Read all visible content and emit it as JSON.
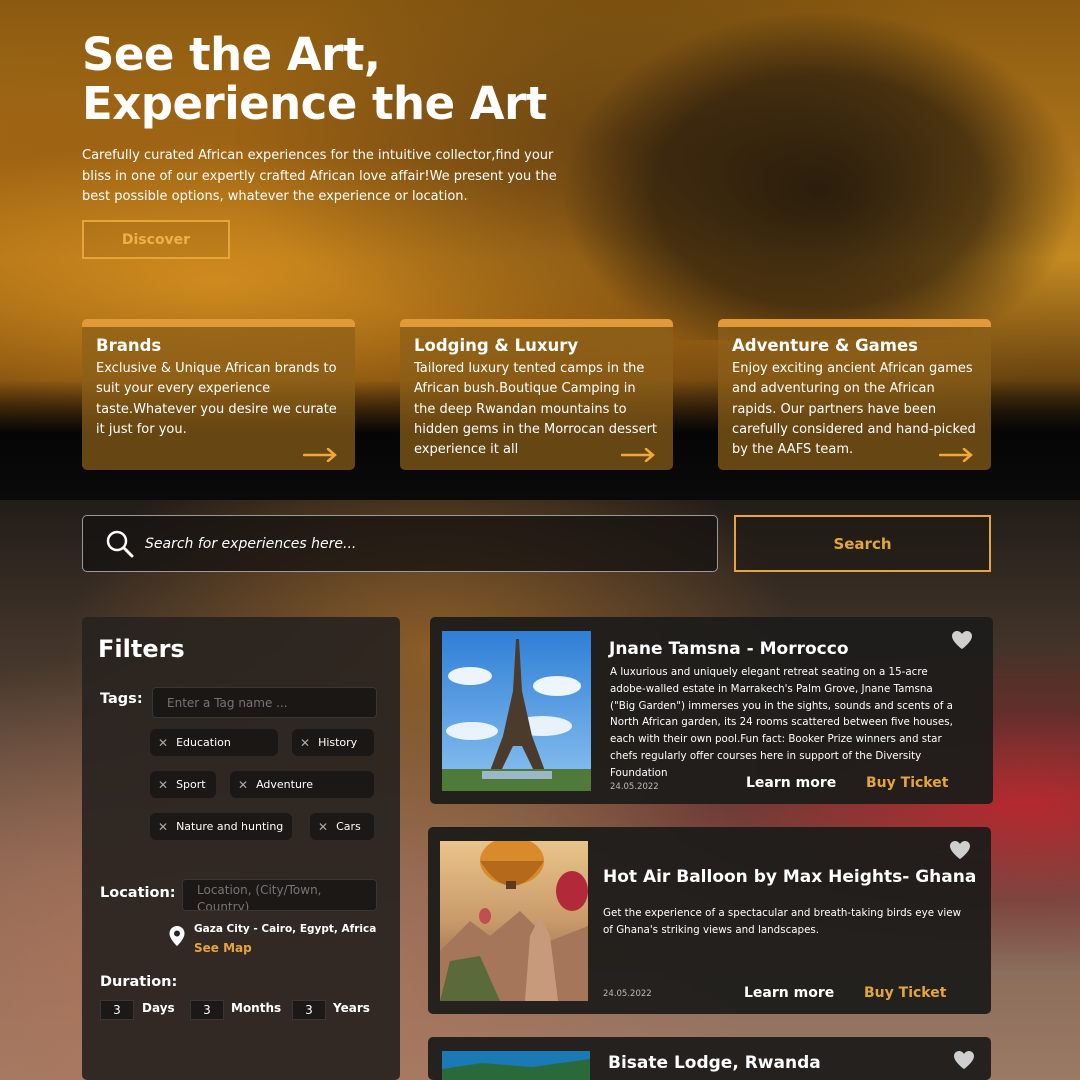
{
  "hero": {
    "title_line1": "See the Art,",
    "title_line2": "Experience the Art",
    "description": "Carefully curated African experiences for the intuitive collector,find your bliss in one of our expertly crafted African love affair!We present you the best possible options, whatever the experience or location.",
    "discover_label": "Discover"
  },
  "cards": [
    {
      "title": "Brands",
      "text": "Exclusive & Unique African brands to suit your every experience taste.Whatever you desire we curate it just for you.",
      "icon": "arrow-right-icon"
    },
    {
      "title": "Lodging & Luxury",
      "text": "Tailored luxury tented camps in the African bush.Boutique Camping in the deep Rwandan mountains to hidden gems in the Morrocan dessert experience it all",
      "icon": "arrow-right-icon"
    },
    {
      "title": "Adventure & Games",
      "text": "Enjoy exciting ancient African games and adventuring on the African rapids. Our partners have been carefully considered and hand-picked by the AAFS team.",
      "icon": "arrow-right-icon"
    }
  ],
  "search": {
    "placeholder": "Search for experiences here...",
    "button_label": "Search",
    "icon": "search-icon"
  },
  "filters": {
    "title": "Filters",
    "tags_label": "Tags:",
    "tag_placeholder": "Enter a Tag name ...",
    "tags": [
      "Education",
      "History",
      "Sport",
      "Adventure",
      "Nature and hunting",
      "Cars"
    ],
    "location_label": "Location:",
    "location_placeholder": "Location, (City/Town, Country)",
    "current_location": "Gaza City - Cairo, Egypt, Africa",
    "see_map": "See Map",
    "duration_label": "Duration:",
    "duration": {
      "days_value": "3",
      "days_label": "Days",
      "months_value": "3",
      "months_label": "Months",
      "years_value": "3",
      "years_label": "Years"
    }
  },
  "results": [
    {
      "title": "Jnane Tamsna - Morrocco",
      "description": "A luxurious and uniquely elegant retreat seating on a 15-acre adobe-walled estate in Marrakech's Palm Grove, Jnane Tamsna (\"Big Garden\") immerses you in the sights, sounds and scents of a North African garden, its 24 rooms scattered between five houses, each with their own pool.Fun fact: Booker Prize winners and star chefs regularly offer courses here in support of the Diversity Foundation",
      "date": "24.05.2022",
      "learn_more": "Learn more",
      "buy_ticket": "Buy Ticket"
    },
    {
      "title": "Hot Air Balloon by Max Heights-  Ghana",
      "description": "Get the experience of a spectacular and breath-taking birds eye view of Ghana's striking views and landscapes.",
      "date": "24.05.2022",
      "learn_more": "Learn more",
      "buy_ticket": "Buy Ticket"
    },
    {
      "title": "Bisate Lodge, Rwanda"
    }
  ],
  "colors": {
    "accent": "#e5a53c",
    "card_bg": "#8c5f19"
  }
}
